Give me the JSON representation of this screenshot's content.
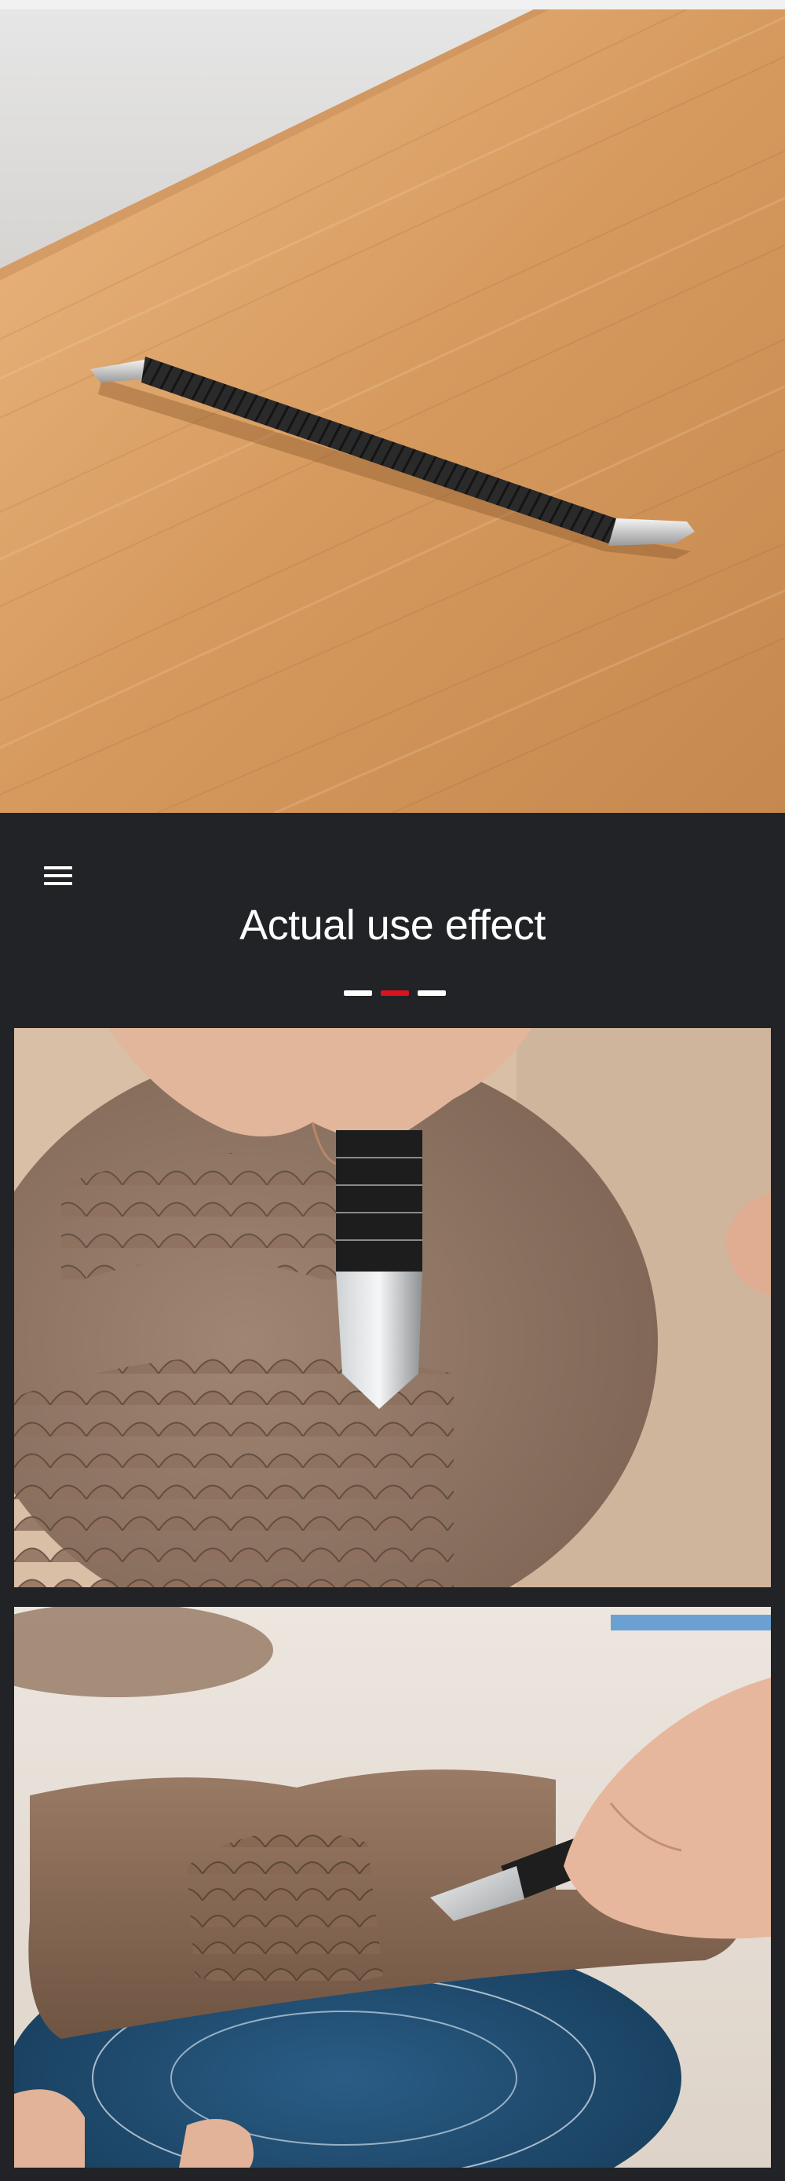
{
  "section": {
    "title": "Actual use effect",
    "menu_icon": "hamburger-menu-icon",
    "divider_colors": [
      "#ffffff",
      "#d9141e",
      "#ffffff"
    ]
  },
  "images": [
    {
      "name": "hero-product-photo",
      "subject": "carving tool on wooden table"
    },
    {
      "name": "usage-photo-1",
      "subject": "hands carving scale pattern into clay slab"
    },
    {
      "name": "usage-photo-2",
      "subject": "hands carving clay on blue banding wheel"
    }
  ],
  "colors": {
    "background": "#222327",
    "accent": "#d9141e",
    "text": "#ffffff"
  }
}
